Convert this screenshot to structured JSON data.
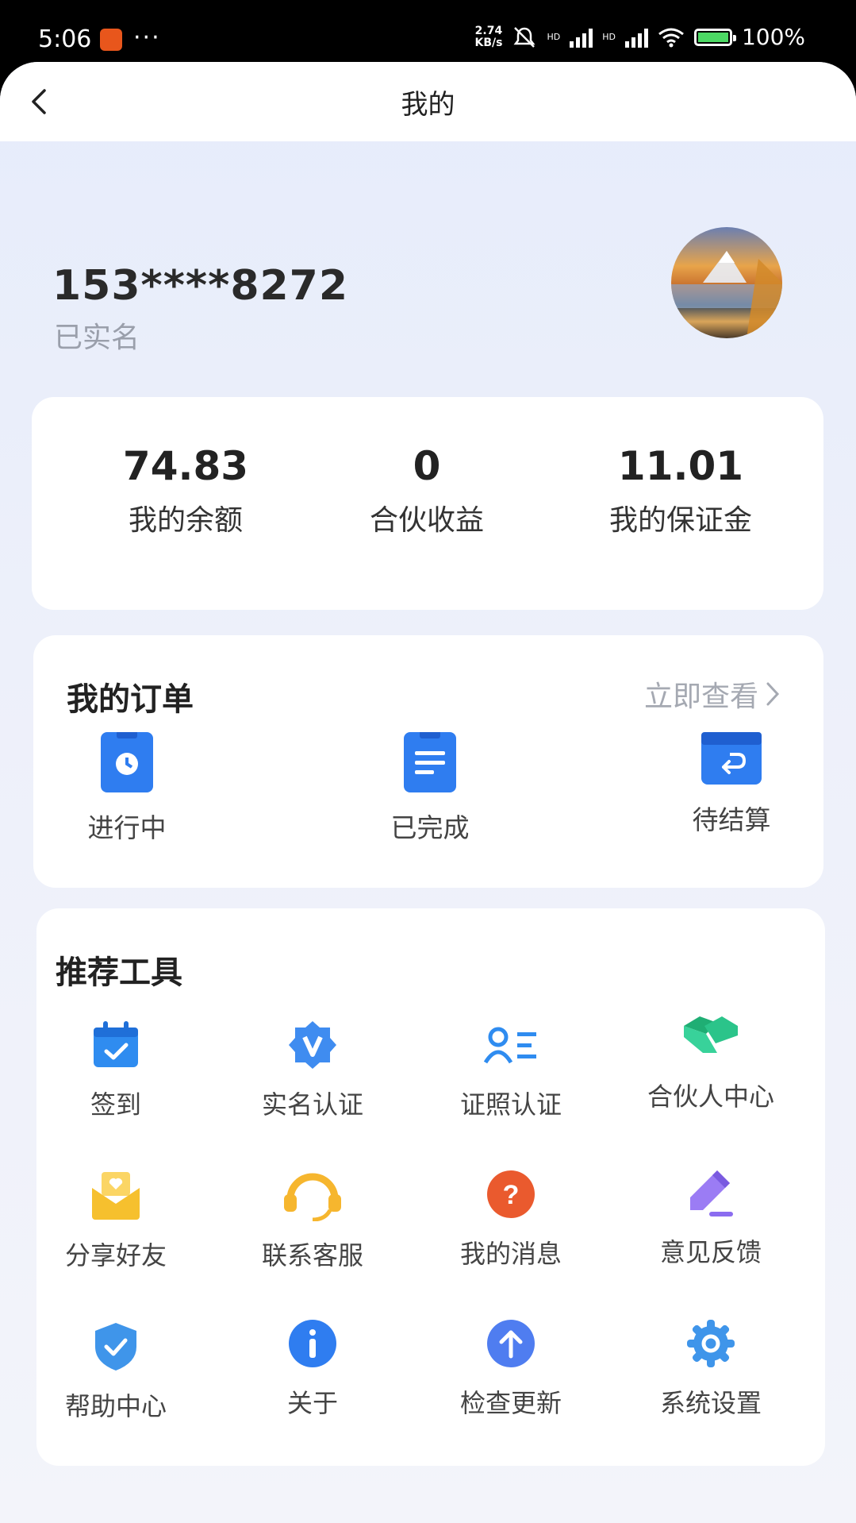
{
  "status_bar": {
    "time": "5:06",
    "dots": "···",
    "net_speed_value": "2.74",
    "net_speed_unit": "KB/s",
    "hd1": "HD",
    "hd2": "HD",
    "battery": "100%"
  },
  "navbar": {
    "title": "我的"
  },
  "profile": {
    "phone": "153****8272",
    "verification": "已实名"
  },
  "stats": [
    {
      "value": "74.83",
      "label": "我的余额"
    },
    {
      "value": "0",
      "label": "合伙收益"
    },
    {
      "value": "11.01",
      "label": "我的保证金"
    }
  ],
  "orders": {
    "title": "我的订单",
    "view_all": "立即查看",
    "items": [
      {
        "label": "进行中",
        "icon": "clipboard-clock-icon"
      },
      {
        "label": "已完成",
        "icon": "clipboard-list-icon"
      },
      {
        "label": "待结算",
        "icon": "box-return-icon"
      }
    ]
  },
  "tools": {
    "title": "推荐工具",
    "items": [
      {
        "label": "签到",
        "icon": "calendar-check-icon",
        "color": "#2f8cf0"
      },
      {
        "label": "实名认证",
        "icon": "verified-badge-icon",
        "color": "#3f8cf0"
      },
      {
        "label": "证照认证",
        "icon": "id-list-icon",
        "color": "#2f8cf0"
      },
      {
        "label": "合伙人中心",
        "icon": "handshake-icon",
        "color": "#2bc48a"
      },
      {
        "label": "分享好友",
        "icon": "envelope-heart-icon",
        "color": "#f6c02e"
      },
      {
        "label": "联系客服",
        "icon": "headset-icon",
        "color": "#f6b62e"
      },
      {
        "label": "我的消息",
        "icon": "question-circle-icon",
        "color": "#ea5a2e"
      },
      {
        "label": "意见反馈",
        "icon": "pencil-icon",
        "color": "#8b6cf0"
      },
      {
        "label": "帮助中心",
        "icon": "shield-check-icon",
        "color": "#3f95ea"
      },
      {
        "label": "关于",
        "icon": "info-circle-icon",
        "color": "#2f7df0"
      },
      {
        "label": "检查更新",
        "icon": "arrow-up-circle-icon",
        "color": "#4f7df0"
      },
      {
        "label": "系统设置",
        "icon": "gear-icon",
        "color": "#3f95ea"
      }
    ]
  }
}
